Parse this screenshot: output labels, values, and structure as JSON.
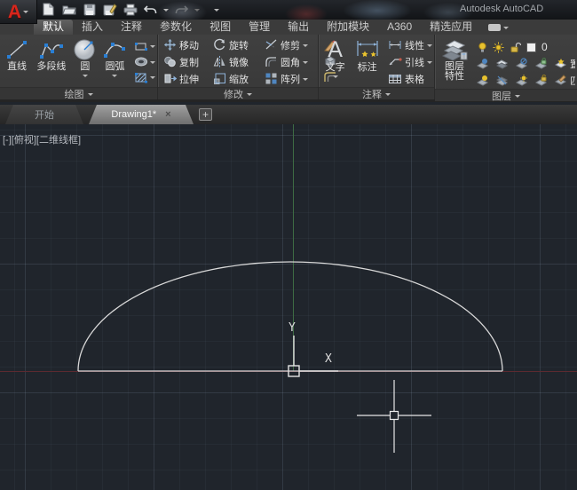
{
  "app": {
    "title": "Autodesk AutoCAD"
  },
  "quick_access_icons": [
    "new-file-icon",
    "open-icon",
    "save-icon",
    "save-as-icon",
    "print-icon",
    "undo-icon",
    "redo-icon",
    "qat-customize-icon"
  ],
  "ribbon": {
    "tabs": [
      {
        "label": "默认",
        "active": true
      },
      {
        "label": "插入"
      },
      {
        "label": "注释"
      },
      {
        "label": "参数化"
      },
      {
        "label": "视图"
      },
      {
        "label": "管理"
      },
      {
        "label": "输出"
      },
      {
        "label": "附加模块"
      },
      {
        "label": "A360"
      },
      {
        "label": "精选应用"
      }
    ],
    "draw": {
      "label": "绘图",
      "line": "直线",
      "polyline": "多段线",
      "circle": "圆",
      "arc": "圆弧"
    },
    "modify": {
      "label": "修改",
      "move": "移动",
      "rotate": "旋转",
      "trim": "修剪",
      "copy": "复制",
      "mirror": "镜像",
      "fillet": "圆角",
      "stretch": "拉伸",
      "scale": "缩放",
      "array": "阵列"
    },
    "annotate": {
      "label": "注释",
      "text": "文字",
      "dimension": "标注",
      "linear": "线性",
      "leader": "引线",
      "table": "表格"
    },
    "layers": {
      "label": "图层",
      "properties_line1": "图层",
      "properties_line2": "特性",
      "current_layer": "0",
      "set_current": "置为当前",
      "match": "匹配图层"
    }
  },
  "file_tabs": {
    "start": "开始",
    "drawing": "Drawing1*",
    "close": "×",
    "new_tab": "+"
  },
  "viewport": {
    "controls": "[-][俯视][二维线框]"
  },
  "canvas": {
    "ucs_x": "X",
    "ucs_y": "Y"
  },
  "colors": {
    "canvas_bg": "#20252c",
    "axis_y_green": "#3e6c44",
    "axis_x_red": "#5c2a30",
    "geometry": "#d8d8d8",
    "accent_blue": "#3f7fbf",
    "logo_red": "#d8261c",
    "star_yellow": "#e8c22e"
  }
}
